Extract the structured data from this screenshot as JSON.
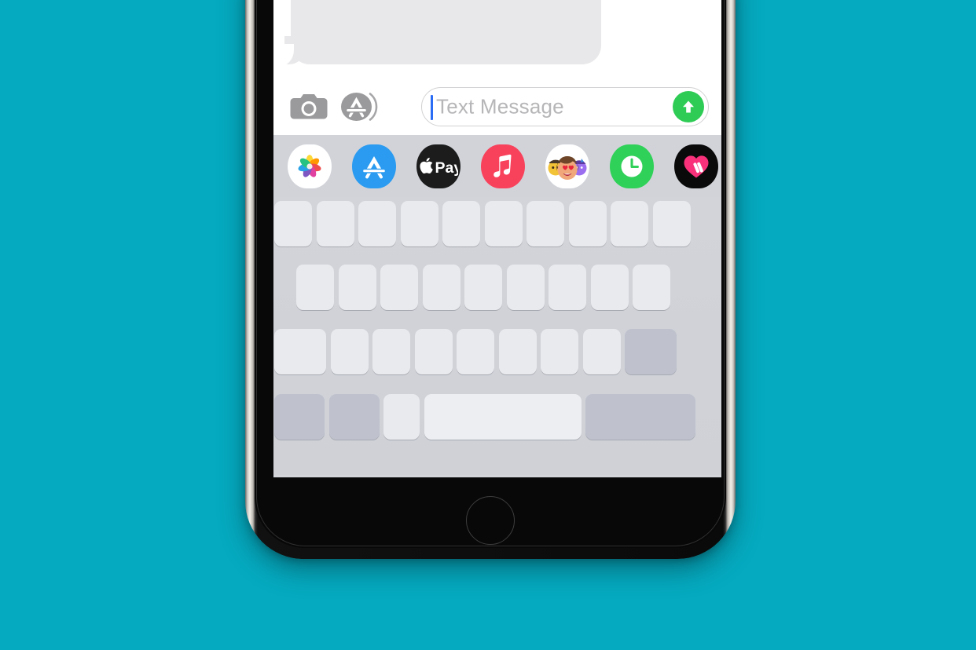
{
  "background": {
    "color": "#05aac0"
  },
  "device": {
    "name": "iPhone",
    "frame_color": "#d7d3cd",
    "bezel_color": "#080808",
    "home_button_label": "Home button"
  },
  "app": {
    "name": "Messages",
    "conversation": {
      "bubbles": [
        {
          "type": "incoming",
          "text": "",
          "color": "#e8e8ea"
        }
      ]
    },
    "input_bar": {
      "camera_label": "Camera",
      "appstore_label": "App Store",
      "placeholder": "Text Message",
      "value": "",
      "send_label": "Send",
      "send_color": "#2ecc55",
      "caret_color": "#2b6cf5",
      "placeholder_color": "#b6b6b8"
    },
    "app_drawer": {
      "background": "#d1d3d9",
      "items": [
        {
          "id": "photos",
          "label": "Photos",
          "icon": "photos-icon",
          "bg": "#ffffff"
        },
        {
          "id": "app-store",
          "label": "App Store",
          "icon": "app-store-icon",
          "bg": "#2a9bf0"
        },
        {
          "id": "apple-pay",
          "label": "Apple Pay",
          "icon": "apple-pay-icon",
          "bg": "#1c1c1c",
          "text": "Pay"
        },
        {
          "id": "apple-music",
          "label": "Music",
          "icon": "music-icon",
          "bg": "#f8425c"
        },
        {
          "id": "memoji",
          "label": "Memoji Stickers",
          "icon": "memoji-icon",
          "bg": "#ffffff"
        },
        {
          "id": "screen-time",
          "label": "Screen Time",
          "icon": "clock-icon",
          "bg": "#30d158"
        },
        {
          "id": "digital-touch",
          "label": "Digital Touch",
          "icon": "digital-touch-icon",
          "bg": "#0a0a0a"
        }
      ]
    },
    "keyboard": {
      "layout": "QWERTY",
      "keys_blank": true,
      "key_color": "#e9eaee",
      "modifier_key_color": "#bfc2cd",
      "background": "#d0d2d8",
      "rows": [
        {
          "id": "row-1",
          "count": 10,
          "keys": [
            "",
            "",
            "",
            "",
            "",
            "",
            "",
            "",
            "",
            ""
          ]
        },
        {
          "id": "row-2",
          "count": 9,
          "keys": [
            "",
            "",
            "",
            "",
            "",
            "",
            "",
            "",
            ""
          ]
        },
        {
          "id": "row-3",
          "count": 9,
          "keys": [
            "",
            "",
            "",
            "",
            "",
            "",
            "",
            "",
            ""
          ]
        },
        {
          "id": "row-4",
          "count": 5,
          "keys": [
            "",
            "",
            "",
            "",
            ""
          ]
        }
      ]
    }
  }
}
